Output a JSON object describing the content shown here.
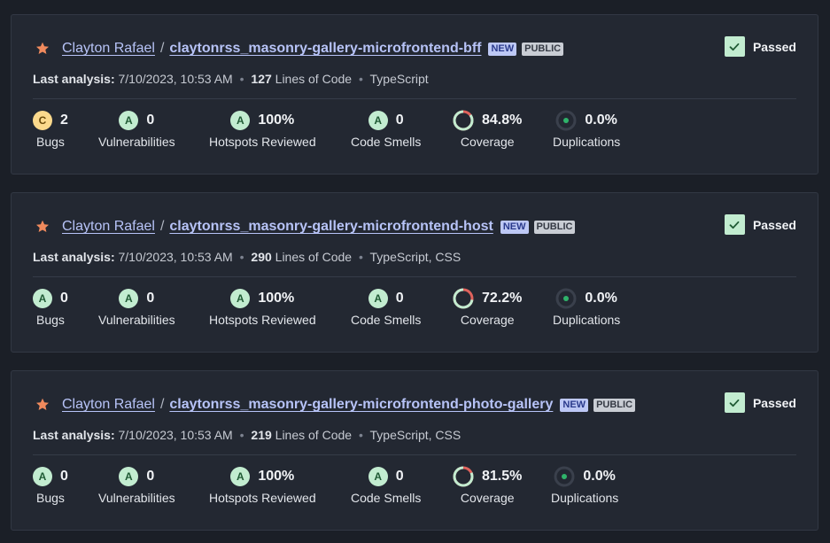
{
  "colors": {
    "accent_link": "#b7c3f7",
    "passed_bg": "#c2ecd0",
    "rating_a": "#c2ecd0",
    "rating_c": "#fbd98c",
    "coverage_good": "#c2ecd0",
    "coverage_bad": "#e0625c",
    "star": "#f08a5d"
  },
  "projects": [
    {
      "org": "Clayton Rafael",
      "separator": "/",
      "repo": "claytonrss_masonry-gallery-microfrontend-bff",
      "badge_new": "NEW",
      "badge_public": "PUBLIC",
      "gate": "Passed",
      "meta_label": "Last analysis:",
      "meta_date": "7/10/2023, 10:53 AM",
      "loc_count": "127",
      "loc_label": "Lines of Code",
      "languages": "TypeScript",
      "bugs": {
        "rating": "C",
        "value": "2",
        "label": "Bugs"
      },
      "vulnerabilities": {
        "rating": "A",
        "value": "0",
        "label": "Vulnerabilities"
      },
      "hotspots": {
        "rating": "A",
        "value": "100%",
        "label": "Hotspots Reviewed"
      },
      "smells": {
        "rating": "A",
        "value": "0",
        "label": "Code Smells"
      },
      "coverage": {
        "value": "84.8%",
        "label": "Coverage",
        "fraction": 0.848
      },
      "duplications": {
        "value": "0.0%",
        "label": "Duplications"
      }
    },
    {
      "org": "Clayton Rafael",
      "separator": "/",
      "repo": "claytonrss_masonry-gallery-microfrontend-host",
      "badge_new": "NEW",
      "badge_public": "PUBLIC",
      "gate": "Passed",
      "meta_label": "Last analysis:",
      "meta_date": "7/10/2023, 10:53 AM",
      "loc_count": "290",
      "loc_label": "Lines of Code",
      "languages": "TypeScript, CSS",
      "bugs": {
        "rating": "A",
        "value": "0",
        "label": "Bugs"
      },
      "vulnerabilities": {
        "rating": "A",
        "value": "0",
        "label": "Vulnerabilities"
      },
      "hotspots": {
        "rating": "A",
        "value": "100%",
        "label": "Hotspots Reviewed"
      },
      "smells": {
        "rating": "A",
        "value": "0",
        "label": "Code Smells"
      },
      "coverage": {
        "value": "72.2%",
        "label": "Coverage",
        "fraction": 0.722
      },
      "duplications": {
        "value": "0.0%",
        "label": "Duplications"
      }
    },
    {
      "org": "Clayton Rafael",
      "separator": "/",
      "repo": "claytonrss_masonry-gallery-microfrontend-photo-gallery",
      "badge_new": "NEW",
      "badge_public": "PUBLIC",
      "gate": "Passed",
      "meta_label": "Last analysis:",
      "meta_date": "7/10/2023, 10:53 AM",
      "loc_count": "219",
      "loc_label": "Lines of Code",
      "languages": "TypeScript, CSS",
      "bugs": {
        "rating": "A",
        "value": "0",
        "label": "Bugs"
      },
      "vulnerabilities": {
        "rating": "A",
        "value": "0",
        "label": "Vulnerabilities"
      },
      "hotspots": {
        "rating": "A",
        "value": "100%",
        "label": "Hotspots Reviewed"
      },
      "smells": {
        "rating": "A",
        "value": "0",
        "label": "Code Smells"
      },
      "coverage": {
        "value": "81.5%",
        "label": "Coverage",
        "fraction": 0.815
      },
      "duplications": {
        "value": "0.0%",
        "label": "Duplications"
      }
    }
  ]
}
